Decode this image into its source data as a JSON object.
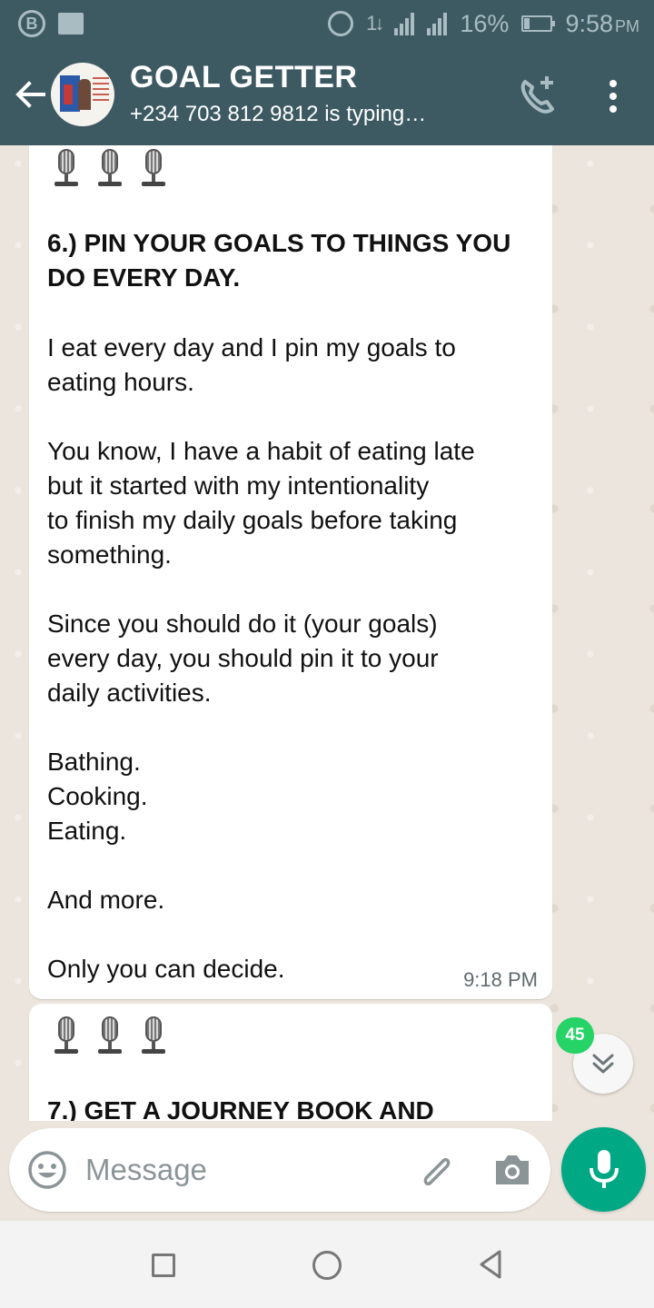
{
  "status_bar": {
    "battery": "16%",
    "time": "9:58",
    "time_suffix": "PM",
    "data_label": "1↓"
  },
  "header": {
    "title": "GOAL GETTER",
    "subtitle": "+234 703 812 9812 is typing…"
  },
  "messages": [
    {
      "heading": "6.) PIN YOUR GOALS TO THINGS YOU DO EVERY DAY.",
      "lines": [
        "I eat every day and I pin my goals to",
        "eating hours.",
        "",
        "You know, I have a habit of eating late",
        "but it started with my intentionality",
        "to finish my daily goals before taking",
        "something.",
        "",
        "Since you should do it (your goals)",
        "every day, you should pin it to your",
        "daily activities.",
        "",
        "Bathing.",
        "Cooking.",
        "Eating.",
        "",
        "And more.",
        "",
        "Only you can decide."
      ],
      "time": "9:18 PM"
    },
    {
      "heading": "7.) GET A JOURNEY BOOK AND"
    }
  ],
  "unread_count": "45",
  "composer": {
    "placeholder": "Message"
  },
  "colors": {
    "header_bg": "#3d5a63",
    "chat_bg": "#ece5dd",
    "accent_green": "#00a884",
    "badge_green": "#25d366"
  }
}
